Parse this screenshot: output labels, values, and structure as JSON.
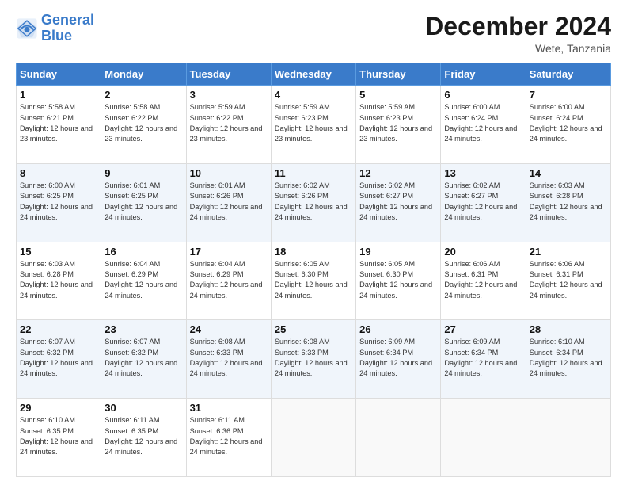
{
  "logo": {
    "line1": "General",
    "line2": "Blue"
  },
  "title": "December 2024",
  "location": "Wete, Tanzania",
  "days_of_week": [
    "Sunday",
    "Monday",
    "Tuesday",
    "Wednesday",
    "Thursday",
    "Friday",
    "Saturday"
  ],
  "weeks": [
    [
      {
        "day": "1",
        "sunrise": "Sunrise: 5:58 AM",
        "sunset": "Sunset: 6:21 PM",
        "daylight": "Daylight: 12 hours and 23 minutes."
      },
      {
        "day": "2",
        "sunrise": "Sunrise: 5:58 AM",
        "sunset": "Sunset: 6:22 PM",
        "daylight": "Daylight: 12 hours and 23 minutes."
      },
      {
        "day": "3",
        "sunrise": "Sunrise: 5:59 AM",
        "sunset": "Sunset: 6:22 PM",
        "daylight": "Daylight: 12 hours and 23 minutes."
      },
      {
        "day": "4",
        "sunrise": "Sunrise: 5:59 AM",
        "sunset": "Sunset: 6:23 PM",
        "daylight": "Daylight: 12 hours and 23 minutes."
      },
      {
        "day": "5",
        "sunrise": "Sunrise: 5:59 AM",
        "sunset": "Sunset: 6:23 PM",
        "daylight": "Daylight: 12 hours and 23 minutes."
      },
      {
        "day": "6",
        "sunrise": "Sunrise: 6:00 AM",
        "sunset": "Sunset: 6:24 PM",
        "daylight": "Daylight: 12 hours and 24 minutes."
      },
      {
        "day": "7",
        "sunrise": "Sunrise: 6:00 AM",
        "sunset": "Sunset: 6:24 PM",
        "daylight": "Daylight: 12 hours and 24 minutes."
      }
    ],
    [
      {
        "day": "8",
        "sunrise": "Sunrise: 6:00 AM",
        "sunset": "Sunset: 6:25 PM",
        "daylight": "Daylight: 12 hours and 24 minutes."
      },
      {
        "day": "9",
        "sunrise": "Sunrise: 6:01 AM",
        "sunset": "Sunset: 6:25 PM",
        "daylight": "Daylight: 12 hours and 24 minutes."
      },
      {
        "day": "10",
        "sunrise": "Sunrise: 6:01 AM",
        "sunset": "Sunset: 6:26 PM",
        "daylight": "Daylight: 12 hours and 24 minutes."
      },
      {
        "day": "11",
        "sunrise": "Sunrise: 6:02 AM",
        "sunset": "Sunset: 6:26 PM",
        "daylight": "Daylight: 12 hours and 24 minutes."
      },
      {
        "day": "12",
        "sunrise": "Sunrise: 6:02 AM",
        "sunset": "Sunset: 6:27 PM",
        "daylight": "Daylight: 12 hours and 24 minutes."
      },
      {
        "day": "13",
        "sunrise": "Sunrise: 6:02 AM",
        "sunset": "Sunset: 6:27 PM",
        "daylight": "Daylight: 12 hours and 24 minutes."
      },
      {
        "day": "14",
        "sunrise": "Sunrise: 6:03 AM",
        "sunset": "Sunset: 6:28 PM",
        "daylight": "Daylight: 12 hours and 24 minutes."
      }
    ],
    [
      {
        "day": "15",
        "sunrise": "Sunrise: 6:03 AM",
        "sunset": "Sunset: 6:28 PM",
        "daylight": "Daylight: 12 hours and 24 minutes."
      },
      {
        "day": "16",
        "sunrise": "Sunrise: 6:04 AM",
        "sunset": "Sunset: 6:29 PM",
        "daylight": "Daylight: 12 hours and 24 minutes."
      },
      {
        "day": "17",
        "sunrise": "Sunrise: 6:04 AM",
        "sunset": "Sunset: 6:29 PM",
        "daylight": "Daylight: 12 hours and 24 minutes."
      },
      {
        "day": "18",
        "sunrise": "Sunrise: 6:05 AM",
        "sunset": "Sunset: 6:30 PM",
        "daylight": "Daylight: 12 hours and 24 minutes."
      },
      {
        "day": "19",
        "sunrise": "Sunrise: 6:05 AM",
        "sunset": "Sunset: 6:30 PM",
        "daylight": "Daylight: 12 hours and 24 minutes."
      },
      {
        "day": "20",
        "sunrise": "Sunrise: 6:06 AM",
        "sunset": "Sunset: 6:31 PM",
        "daylight": "Daylight: 12 hours and 24 minutes."
      },
      {
        "day": "21",
        "sunrise": "Sunrise: 6:06 AM",
        "sunset": "Sunset: 6:31 PM",
        "daylight": "Daylight: 12 hours and 24 minutes."
      }
    ],
    [
      {
        "day": "22",
        "sunrise": "Sunrise: 6:07 AM",
        "sunset": "Sunset: 6:32 PM",
        "daylight": "Daylight: 12 hours and 24 minutes."
      },
      {
        "day": "23",
        "sunrise": "Sunrise: 6:07 AM",
        "sunset": "Sunset: 6:32 PM",
        "daylight": "Daylight: 12 hours and 24 minutes."
      },
      {
        "day": "24",
        "sunrise": "Sunrise: 6:08 AM",
        "sunset": "Sunset: 6:33 PM",
        "daylight": "Daylight: 12 hours and 24 minutes."
      },
      {
        "day": "25",
        "sunrise": "Sunrise: 6:08 AM",
        "sunset": "Sunset: 6:33 PM",
        "daylight": "Daylight: 12 hours and 24 minutes."
      },
      {
        "day": "26",
        "sunrise": "Sunrise: 6:09 AM",
        "sunset": "Sunset: 6:34 PM",
        "daylight": "Daylight: 12 hours and 24 minutes."
      },
      {
        "day": "27",
        "sunrise": "Sunrise: 6:09 AM",
        "sunset": "Sunset: 6:34 PM",
        "daylight": "Daylight: 12 hours and 24 minutes."
      },
      {
        "day": "28",
        "sunrise": "Sunrise: 6:10 AM",
        "sunset": "Sunset: 6:34 PM",
        "daylight": "Daylight: 12 hours and 24 minutes."
      }
    ],
    [
      {
        "day": "29",
        "sunrise": "Sunrise: 6:10 AM",
        "sunset": "Sunset: 6:35 PM",
        "daylight": "Daylight: 12 hours and 24 minutes."
      },
      {
        "day": "30",
        "sunrise": "Sunrise: 6:11 AM",
        "sunset": "Sunset: 6:35 PM",
        "daylight": "Daylight: 12 hours and 24 minutes."
      },
      {
        "day": "31",
        "sunrise": "Sunrise: 6:11 AM",
        "sunset": "Sunset: 6:36 PM",
        "daylight": "Daylight: 12 hours and 24 minutes."
      },
      null,
      null,
      null,
      null
    ]
  ]
}
